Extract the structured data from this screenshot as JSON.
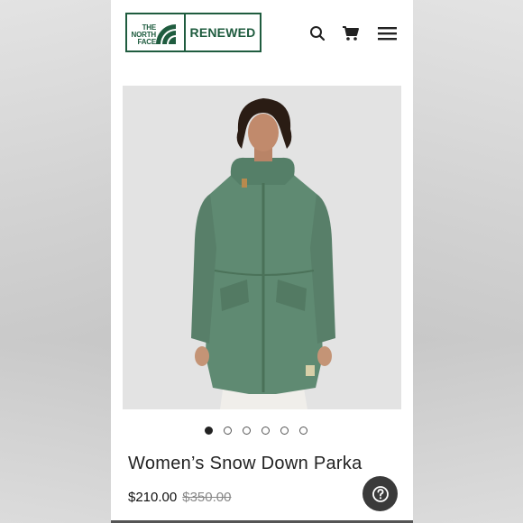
{
  "brand": {
    "name_lines": [
      "THE",
      "NORTH",
      "FACE"
    ],
    "renewed_label": "RENEWED",
    "color": "#1f5c3f"
  },
  "header_icons": [
    "search-icon",
    "cart-icon",
    "menu-icon"
  ],
  "gallery": {
    "image_count": 6,
    "active_index": 0
  },
  "product": {
    "title": "Women’s Snow Down Parka",
    "price": "$210.00",
    "original_price": "$350.00"
  },
  "help_icon": "question-icon",
  "colors": {
    "jacket": "#5f8a72",
    "background": "#e3e3e3"
  }
}
